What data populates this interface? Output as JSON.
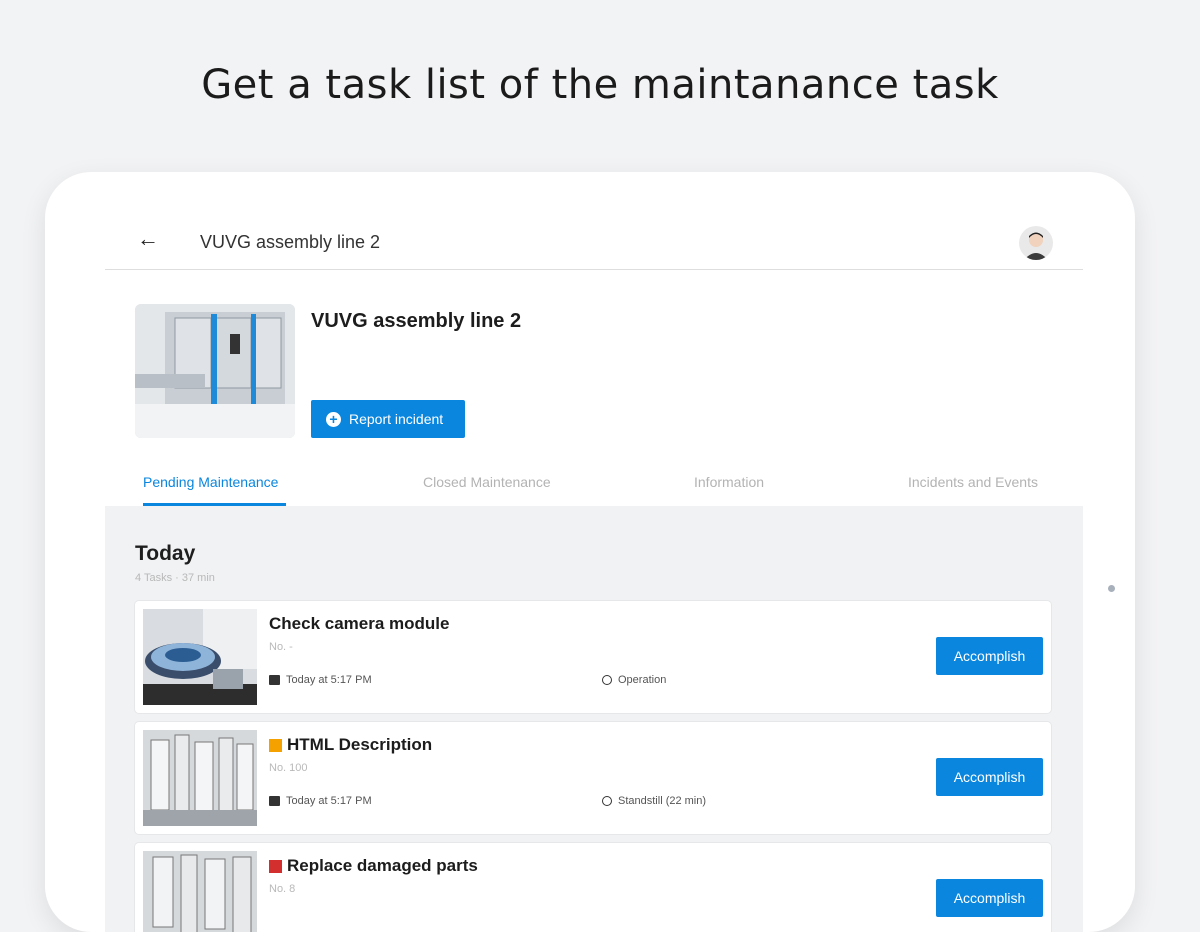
{
  "headline": "Get a task list of the maintanance task",
  "topbar": {
    "title": "VUVG assembly line 2",
    "back_icon": "arrow-left-icon",
    "avatar_icon": "user-avatar"
  },
  "asset": {
    "title": "VUVG assembly line 2",
    "report_button": "Report incident"
  },
  "tabs": [
    {
      "label": "Pending Maintenance",
      "active": true
    },
    {
      "label": "Closed Maintenance",
      "active": false
    },
    {
      "label": "Information",
      "active": false
    },
    {
      "label": "Incidents and Events",
      "active": false
    }
  ],
  "section": {
    "title": "Today",
    "subtitle": "4 Tasks · 37 min"
  },
  "tasks": [
    {
      "title": "Check camera module",
      "number": "No. -",
      "date": "Today at 5:17 PM",
      "type": "Operation",
      "priority_color": "",
      "button": "Accomplish"
    },
    {
      "title": "HTML Description",
      "number": "No. 100",
      "date": "Today at 5:17 PM",
      "type": "Standstill (22 min)",
      "priority_color": "#f5a100",
      "button": "Accomplish"
    },
    {
      "title": "Replace damaged parts",
      "number": "No. 8",
      "date": "",
      "type": "",
      "priority_color": "#d32f2f",
      "button": "Accomplish"
    }
  ],
  "colors": {
    "accent": "#0a86de",
    "background": "#f2f3f5"
  }
}
